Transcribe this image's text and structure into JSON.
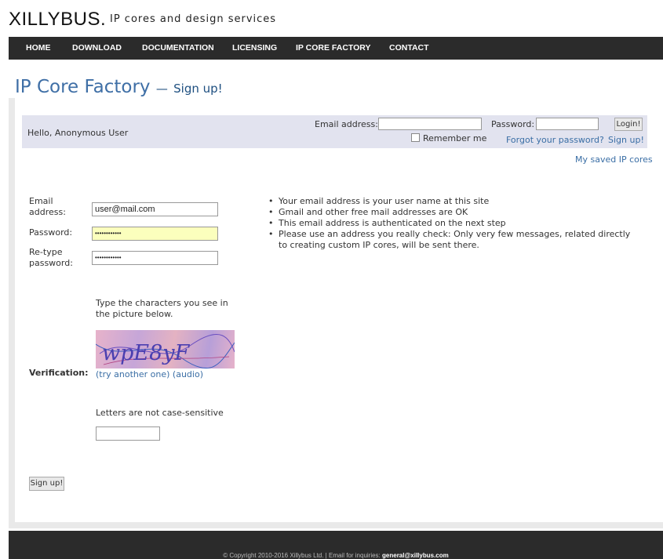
{
  "header": {
    "logo": "XILLYBUS.",
    "tagline": "IP cores and design services"
  },
  "nav": {
    "items": [
      {
        "label": "HOME"
      },
      {
        "label": "DOWNLOAD"
      },
      {
        "label": "DOCUMENTATION"
      },
      {
        "label": "LICENSING"
      },
      {
        "label": "IP CORE FACTORY"
      },
      {
        "label": "CONTACT"
      }
    ]
  },
  "page": {
    "title": "IP Core Factory",
    "dash": "—",
    "subtitle": "Sign up!"
  },
  "login": {
    "greeting": "Hello, Anonymous User",
    "email_label": "Email address:",
    "password_label": "Password:",
    "login_button": "Login!",
    "remember_label": "Remember me",
    "remember_checked": false,
    "forgot_link": "Forgot your password?",
    "signup_link": "Sign up!"
  },
  "saved_link": "My saved IP cores",
  "form": {
    "email_label_1": "Email",
    "email_label_2": "address:",
    "email_value": "user@mail.com",
    "password_label": "Password:",
    "password_mask": "••••••••••••",
    "retype_label_1": "Re-type",
    "retype_label_2": "password:",
    "retype_mask": "••••••••••••",
    "verification_label": "Verification:",
    "captcha_instruction_1": "Type the characters you see in",
    "captcha_instruction_2": "the picture below.",
    "captcha_text": "wpE8yF",
    "try_another": "(try another one)",
    "audio": "(audio)",
    "case_note": "Letters are not case-sensitive",
    "captcha_answer": "",
    "submit": "Sign up!"
  },
  "notes": [
    "Your email address is your user name at this site",
    "Gmail and other free mail addresses are OK",
    "This email address is authenticated on the next step",
    "Please use an address you really check: Only very few messages, related directly to creating custom IP cores, will be sent there."
  ],
  "footer": {
    "copyright": "© Copyright 2010-2016 Xillybus Ltd. | Email for inquiries: ",
    "email": "general@xillybus.com"
  },
  "colors": {
    "title_blue": "#3f6fa6",
    "link_blue": "#3a6ea5",
    "nav_bg": "#2b2b2b",
    "login_bar_bg": "#e2e3ef",
    "highlight_input": "#fbffbd"
  }
}
